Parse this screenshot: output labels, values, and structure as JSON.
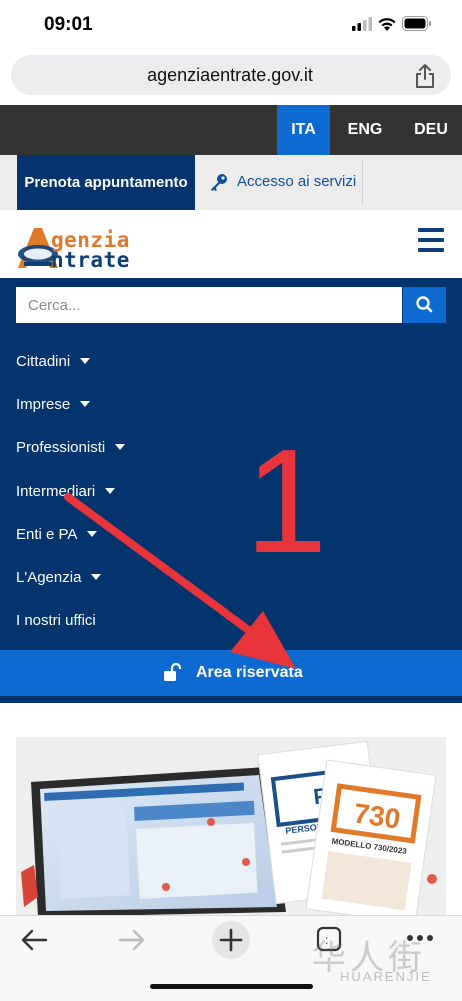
{
  "status_bar": {
    "time": "09:01"
  },
  "browser": {
    "url": "agenziaentrate.gov.it"
  },
  "languages": [
    {
      "label": "ITA",
      "active": true
    },
    {
      "label": "ENG",
      "active": false
    },
    {
      "label": "DEU",
      "active": false
    }
  ],
  "service_bar": {
    "book_label": "Prenota appuntamento",
    "access_label": "Accesso ai servizi"
  },
  "logo": {
    "line1": "genzia",
    "line2": "ntrate"
  },
  "search": {
    "placeholder": "Cerca..."
  },
  "nav": {
    "items": [
      {
        "label": "Cittadini",
        "has_submenu": true
      },
      {
        "label": "Imprese",
        "has_submenu": true
      },
      {
        "label": "Professionisti",
        "has_submenu": true
      },
      {
        "label": "Intermediari",
        "has_submenu": true
      },
      {
        "label": "Enti e PA",
        "has_submenu": true
      },
      {
        "label": "L'Agenzia",
        "has_submenu": true
      },
      {
        "label": "I nostri uffici",
        "has_submenu": false
      }
    ],
    "reserved_area_label": "Area riservata"
  },
  "promo": {
    "card1_title": "PERSONE",
    "card2_title": "730",
    "card2_caption": "MODELLO 730/2023"
  },
  "annotation": {
    "step": "1"
  },
  "watermark": {
    "text": "华人街",
    "subtext": "HUARENJIE"
  },
  "colors": {
    "brand_dark": "#03346d",
    "brand_blue": "#0d6ad1",
    "lang_bar": "#333333",
    "annotation_red": "#e8343b",
    "logo_orange": "#e07a2a"
  },
  "icons": [
    "signal-icon",
    "wifi-icon",
    "battery-icon",
    "share-icon",
    "key-icon",
    "hamburger-icon",
    "search-icon",
    "lock-icon",
    "back-icon",
    "forward-icon",
    "new-tab-icon",
    "tabs-icon",
    "more-icon"
  ]
}
